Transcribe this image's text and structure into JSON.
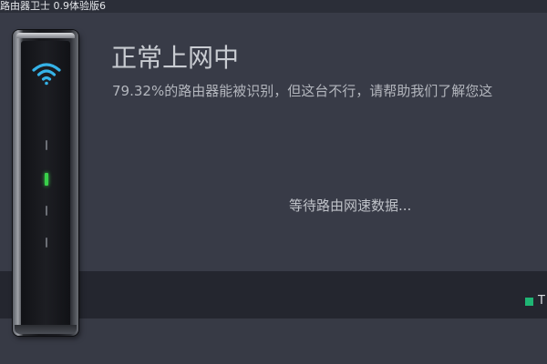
{
  "window": {
    "title": "路由器卫士 0.9体验版6"
  },
  "status": {
    "headline": "正常上网中",
    "message": "79.32%的路由器能被识别，但这台不行，请帮助我们了解您这",
    "waiting": "等待路由网速数据..."
  },
  "legend": {
    "label": "T",
    "color": "#1fb574"
  },
  "router": {
    "wifi_color": "#35b3e8",
    "active_led_color": "#39d04a",
    "icon": "wifi-icon"
  }
}
